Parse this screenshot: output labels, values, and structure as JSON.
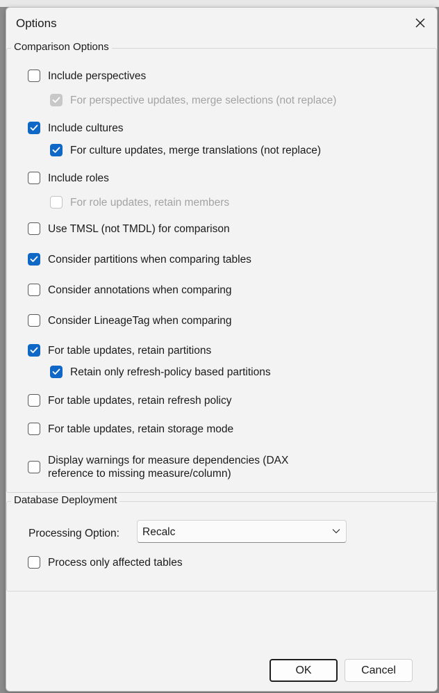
{
  "dialog": {
    "title": "Options",
    "close_icon": "close-icon"
  },
  "comparison": {
    "group_label": "Comparison Options",
    "options": [
      {
        "label": "Include perspectives",
        "checked": false,
        "disabled": false
      },
      {
        "label": "For perspective updates, merge selections (not replace)",
        "checked": true,
        "disabled": true
      },
      {
        "label": "Include cultures",
        "checked": true,
        "disabled": false
      },
      {
        "label": "For culture updates, merge translations (not replace)",
        "checked": true,
        "disabled": false
      },
      {
        "label": "Include roles",
        "checked": false,
        "disabled": false
      },
      {
        "label": "For role updates, retain members",
        "checked": false,
        "disabled": true
      },
      {
        "label": "Use TMSL (not TMDL) for comparison",
        "checked": false,
        "disabled": false
      },
      {
        "label": "Consider partitions when comparing tables",
        "checked": true,
        "disabled": false
      },
      {
        "label": "Consider annotations when comparing",
        "checked": false,
        "disabled": false
      },
      {
        "label": "Consider LineageTag when comparing",
        "checked": false,
        "disabled": false
      },
      {
        "label": "For table updates, retain partitions",
        "checked": true,
        "disabled": false
      },
      {
        "label": "Retain only refresh-policy based partitions",
        "checked": true,
        "disabled": false
      },
      {
        "label": "For table updates, retain refresh policy",
        "checked": false,
        "disabled": false
      },
      {
        "label": "For table updates, retain storage mode",
        "checked": false,
        "disabled": false
      },
      {
        "label": "Display warnings for measure dependencies (DAX",
        "label_line2": "reference to missing measure/column)",
        "checked": false,
        "disabled": false
      }
    ]
  },
  "deployment": {
    "group_label": "Database Deployment",
    "processing_label": "Processing Option:",
    "processing_value": "Recalc",
    "process_affected": {
      "label": "Process only affected tables",
      "checked": false
    }
  },
  "buttons": {
    "ok": "OK",
    "cancel": "Cancel"
  },
  "colors": {
    "accent": "#0f67c6",
    "dialog_bg": "#f3f3f3",
    "disabled_text": "#a3a3a3"
  }
}
